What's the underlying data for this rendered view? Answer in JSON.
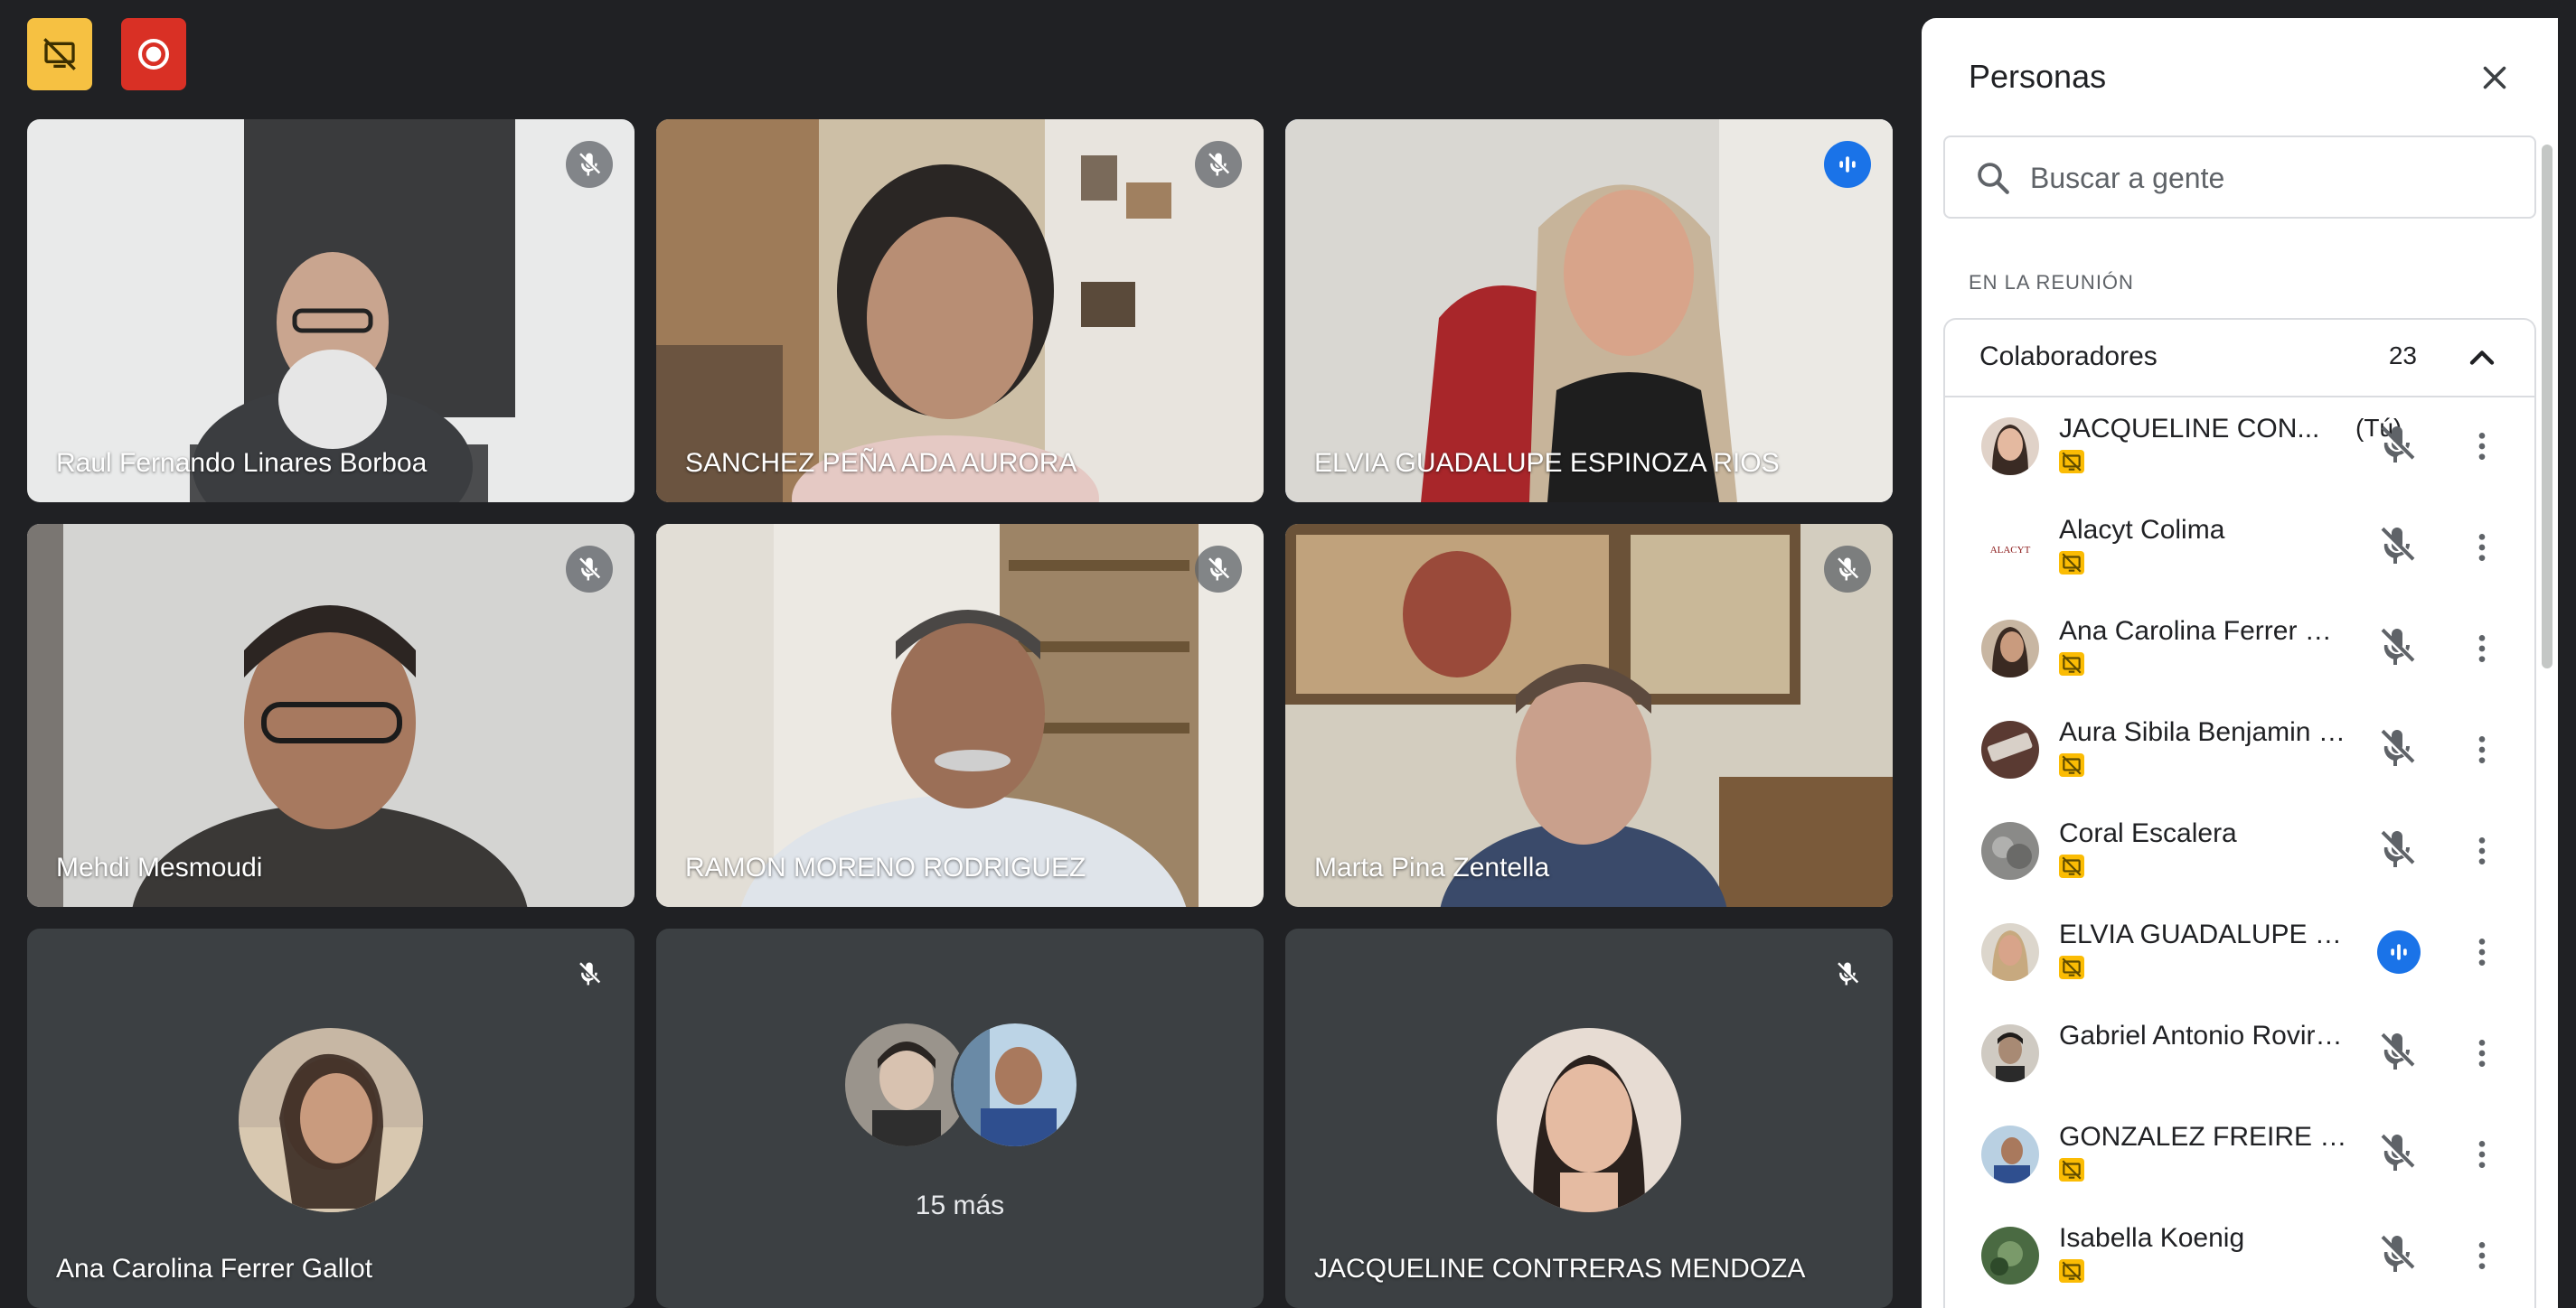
{
  "colors": {
    "meet_bg": "#202124",
    "tile_bg": "#3c4043",
    "accent": "#1a73e8",
    "active_border": "#8ab4f8",
    "present_yellow": "#fbbc04",
    "record_red": "#d93025"
  },
  "top_buttons": [
    {
      "name": "presentation-off-icon",
      "color": "#f6c142"
    },
    {
      "name": "record-icon",
      "color": "#d93025"
    }
  ],
  "tiles": [
    {
      "name": "Raul Fernando Linares Borboa",
      "muted": true
    },
    {
      "name": "SANCHEZ PEÑA ADA AURORA",
      "muted": true
    },
    {
      "name": "ELVIA GUADALUPE ESPINOZA RIOS",
      "speaking": true
    },
    {
      "name": "Mehdi Mesmoudi",
      "muted": true
    },
    {
      "name": "RAMON MORENO RODRIGUEZ",
      "muted": true
    },
    {
      "name": "Marta Pina Zentella",
      "muted": true
    },
    {
      "name": "Ana Carolina Ferrer Gallot",
      "muted": true
    },
    {
      "more_label": "15 más"
    },
    {
      "name": "JACQUELINE CONTRERAS MENDOZA",
      "muted": true
    }
  ],
  "panel": {
    "title": "Personas",
    "search_placeholder": "Buscar a gente",
    "section_label": "EN LA REUNIÓN",
    "group_title": "Colaboradores",
    "group_count": "23",
    "participants": [
      {
        "name": "JACQUELINE CON...",
        "you": "(Tú)",
        "presenting": true,
        "status": "muted"
      },
      {
        "name": "Alacyt Colima",
        "presenting": true,
        "status": "muted",
        "avatar_text": "ALACYT"
      },
      {
        "name": "Ana Carolina Ferrer Gall...",
        "presenting": true,
        "status": "muted"
      },
      {
        "name": "Aura Sibila Benjamin Mir...",
        "presenting": true,
        "status": "muted"
      },
      {
        "name": "Coral Escalera",
        "presenting": true,
        "status": "muted"
      },
      {
        "name": "ELVIA GUADALUPE ESPI...",
        "presenting": true,
        "status": "speaking"
      },
      {
        "name": "Gabriel Antonio Rovira ...",
        "presenting": false,
        "status": "muted"
      },
      {
        "name": "GONZALEZ FREIRE JOS...",
        "presenting": true,
        "status": "muted"
      },
      {
        "name": "Isabella Koenig",
        "presenting": true,
        "status": "muted"
      }
    ]
  }
}
